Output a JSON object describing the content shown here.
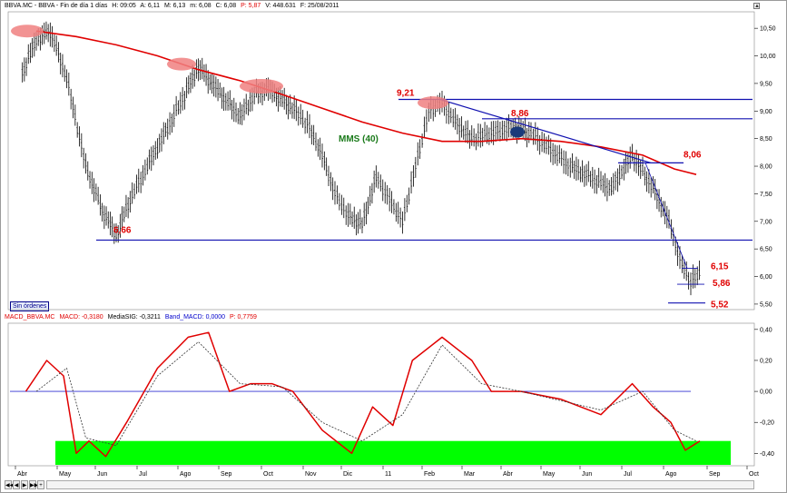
{
  "price_header": {
    "symbol": "BBVA.MC - BBVA - Fin de día 1 días",
    "h": "H: 09:05",
    "a": "A: 6,11",
    "m": "M: 6,13",
    "mn": "m: 6,08",
    "c": "C: 6,08",
    "p": "P: 5,87",
    "v": "V: 448.631",
    "f": "F: 25/08/2011"
  },
  "macd_header": {
    "name": "MACD_BBVA.MC",
    "macd": "MACD: -0,3180",
    "signal": "MediaSIG: -0,3211",
    "band": "Band_MACD: 0,0000",
    "p": "P: 0,7759"
  },
  "orders_label": "Sin órdenes",
  "nav": {
    "first": "◀◀",
    "prev": "◀",
    "next": "▶",
    "last": "▶▶",
    "zoom": "+"
  },
  "colors": {
    "price_bars": "#000000",
    "moving_average": "#e00000",
    "annotation_lines": "#1010b0",
    "annotation_labels": "#e00000",
    "ellipses": "#f08080",
    "dot": "#1a3a7a",
    "macd_line": "#e00000",
    "signal_line": "#333333",
    "zero_line": "#3030d0",
    "oversold_zone": "#00ff00"
  },
  "chart_data": [
    {
      "type": "line",
      "title": "",
      "x": [
        "Abr",
        "May",
        "Jun",
        "Jul",
        "Ago",
        "Sep",
        "Oct",
        "Nov",
        "Dic",
        "11",
        "Feb",
        "Mar",
        "Abr",
        "May",
        "Jun",
        "Jul",
        "Ago",
        "Sep",
        "Oct"
      ],
      "ylim": [
        5.4,
        10.7
      ],
      "yticks": [
        "10,50",
        "10,00",
        "9,50",
        "9,00",
        "8,50",
        "8,00",
        "7,50",
        "7,00",
        "6,50",
        "6,00",
        "5,50"
      ],
      "series": [
        {
          "name": "price",
          "points": [
            [
              "Abr",
              9.7
            ],
            [
              "Abr",
              10.3
            ],
            [
              "Abr",
              10.45
            ],
            [
              "May",
              9.6
            ],
            [
              "May",
              8.0
            ],
            [
              "Jun",
              7.2
            ],
            [
              "Jun",
              6.75
            ],
            [
              "Jun",
              7.4
            ],
            [
              "Jul",
              8.0
            ],
            [
              "Jul",
              8.7
            ],
            [
              "Ago",
              9.3
            ],
            [
              "Ago",
              9.8
            ],
            [
              "Ago",
              9.5
            ],
            [
              "Sep",
              9.2
            ],
            [
              "Sep",
              8.9
            ],
            [
              "Sep",
              9.3
            ],
            [
              "Oct",
              9.4
            ],
            [
              "Oct",
              9.2
            ],
            [
              "Oct",
              9.0
            ],
            [
              "Nov",
              8.7
            ],
            [
              "Nov",
              8.2
            ],
            [
              "Nov",
              7.5
            ],
            [
              "Dic",
              7.1
            ],
            [
              "Dic",
              6.95
            ],
            [
              "Dic",
              7.8
            ],
            [
              "11",
              7.4
            ],
            [
              "11",
              7.0
            ],
            [
              "11",
              8.0
            ],
            [
              "Feb",
              9.0
            ],
            [
              "Feb",
              9.15
            ],
            [
              "Feb",
              8.8
            ],
            [
              "Mar",
              8.5
            ],
            [
              "Mar",
              8.6
            ],
            [
              "Abr",
              8.7
            ],
            [
              "Abr",
              8.6
            ],
            [
              "May",
              8.3
            ],
            [
              "May",
              8.0
            ],
            [
              "Jun",
              7.8
            ],
            [
              "Jun",
              7.6
            ],
            [
              "Jul",
              8.2
            ],
            [
              "Jul",
              7.6
            ],
            [
              "Ago",
              7.0
            ],
            [
              "Ago",
              6.3
            ],
            [
              "Ago",
              5.9
            ],
            [
              "Ago",
              6.1
            ]
          ]
        },
        {
          "name": "MMS (40)",
          "points": [
            [
              "Abr",
              10.45
            ],
            [
              "May",
              10.35
            ],
            [
              "Jun",
              10.2
            ],
            [
              "Jul",
              10.0
            ],
            [
              "Ago",
              9.75
            ],
            [
              "Sep",
              9.55
            ],
            [
              "Oct",
              9.3
            ],
            [
              "Nov",
              9.05
            ],
            [
              "Dic",
              8.8
            ],
            [
              "11",
              8.6
            ],
            [
              "Feb",
              8.45
            ],
            [
              "Mar",
              8.45
            ],
            [
              "Abr",
              8.5
            ],
            [
              "May",
              8.45
            ],
            [
              "Jun",
              8.35
            ],
            [
              "Jul",
              8.2
            ],
            [
              "Ago",
              7.95
            ],
            [
              "Ago",
              7.85
            ]
          ]
        }
      ],
      "annotations": [
        "9,21",
        "8,86",
        "8,06",
        "6,66",
        "6,15",
        "5,86",
        "5,52",
        "MMS (40)"
      ]
    },
    {
      "type": "line",
      "title": "",
      "ylim": [
        -0.48,
        0.44
      ],
      "yticks": [
        "0,40",
        "0,20",
        "0,00",
        "-0,20",
        "-0,40"
      ],
      "series": [
        {
          "name": "MACD",
          "points": [
            [
              "Abr",
              0.0
            ],
            [
              "Abr",
              0.2
            ],
            [
              "May",
              0.1
            ],
            [
              "May",
              -0.4
            ],
            [
              "May",
              -0.32
            ],
            [
              "Jun",
              -0.42
            ],
            [
              "Jun",
              -0.2
            ],
            [
              "Jul",
              0.15
            ],
            [
              "Ago",
              0.35
            ],
            [
              "Ago",
              0.38
            ],
            [
              "Sep",
              0.0
            ],
            [
              "Sep",
              0.05
            ],
            [
              "Oct",
              0.05
            ],
            [
              "Oct",
              0.0
            ],
            [
              "Nov",
              -0.25
            ],
            [
              "Dic",
              -0.4
            ],
            [
              "Dic",
              -0.1
            ],
            [
              "11",
              -0.22
            ],
            [
              "11",
              0.2
            ],
            [
              "Feb",
              0.35
            ],
            [
              "Mar",
              0.2
            ],
            [
              "Mar",
              0.0
            ],
            [
              "Abr",
              0.0
            ],
            [
              "May",
              -0.05
            ],
            [
              "Jun",
              -0.15
            ],
            [
              "Jul",
              0.05
            ],
            [
              "Jul",
              -0.1
            ],
            [
              "Ago",
              -0.2
            ],
            [
              "Ago",
              -0.38
            ],
            [
              "Ago",
              -0.32
            ]
          ]
        },
        {
          "name": "MediaSIG",
          "points": [
            [
              "Abr",
              0.0
            ],
            [
              "May",
              0.15
            ],
            [
              "May",
              -0.3
            ],
            [
              "Jun",
              -0.35
            ],
            [
              "Jul",
              0.1
            ],
            [
              "Ago",
              0.32
            ],
            [
              "Sep",
              0.05
            ],
            [
              "Oct",
              0.03
            ],
            [
              "Nov",
              -0.2
            ],
            [
              "Dic",
              -0.32
            ],
            [
              "11",
              -0.15
            ],
            [
              "Feb",
              0.3
            ],
            [
              "Mar",
              0.05
            ],
            [
              "Abr",
              0.0
            ],
            [
              "Jun",
              -0.12
            ],
            [
              "Jul",
              0.0
            ],
            [
              "Ago",
              -0.25
            ],
            [
              "Ago",
              -0.32
            ]
          ]
        }
      ]
    }
  ]
}
